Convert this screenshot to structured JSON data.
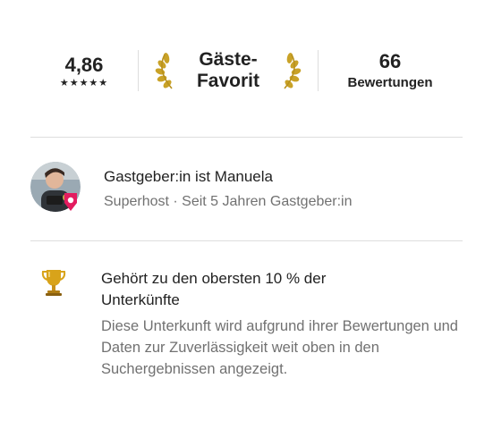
{
  "summary": {
    "rating": "4,86",
    "stars": "★★★★★",
    "guest_favorite_line1": "Gäste-",
    "guest_favorite_line2": "Favorit",
    "reviews_count": "66",
    "reviews_label": "Bewertungen"
  },
  "host": {
    "name": "Gastgeber:in ist Manuela",
    "subtitle": "Superhost · Seit 5 Jahren Gastgeber:in"
  },
  "highlight": {
    "title": "Gehört zu den obersten 10 % der Unterkünfte",
    "description": "Diese Unterkunft wird aufgrund ihrer Bewertungen und Daten zur Zuverlässigkeit weit oben in den Suchergebnissen angezeigt."
  },
  "icons": {
    "laurel": "laurel-icon",
    "superhost_badge": "superhost-badge-icon",
    "trophy": "trophy-icon"
  },
  "colors": {
    "text_primary": "#222222",
    "text_secondary": "#717171",
    "divider": "#dddddd",
    "laurel_gold": "#c9a227",
    "superhost_badge": "#e31c5f",
    "trophy_gold": "#d8a31a"
  }
}
